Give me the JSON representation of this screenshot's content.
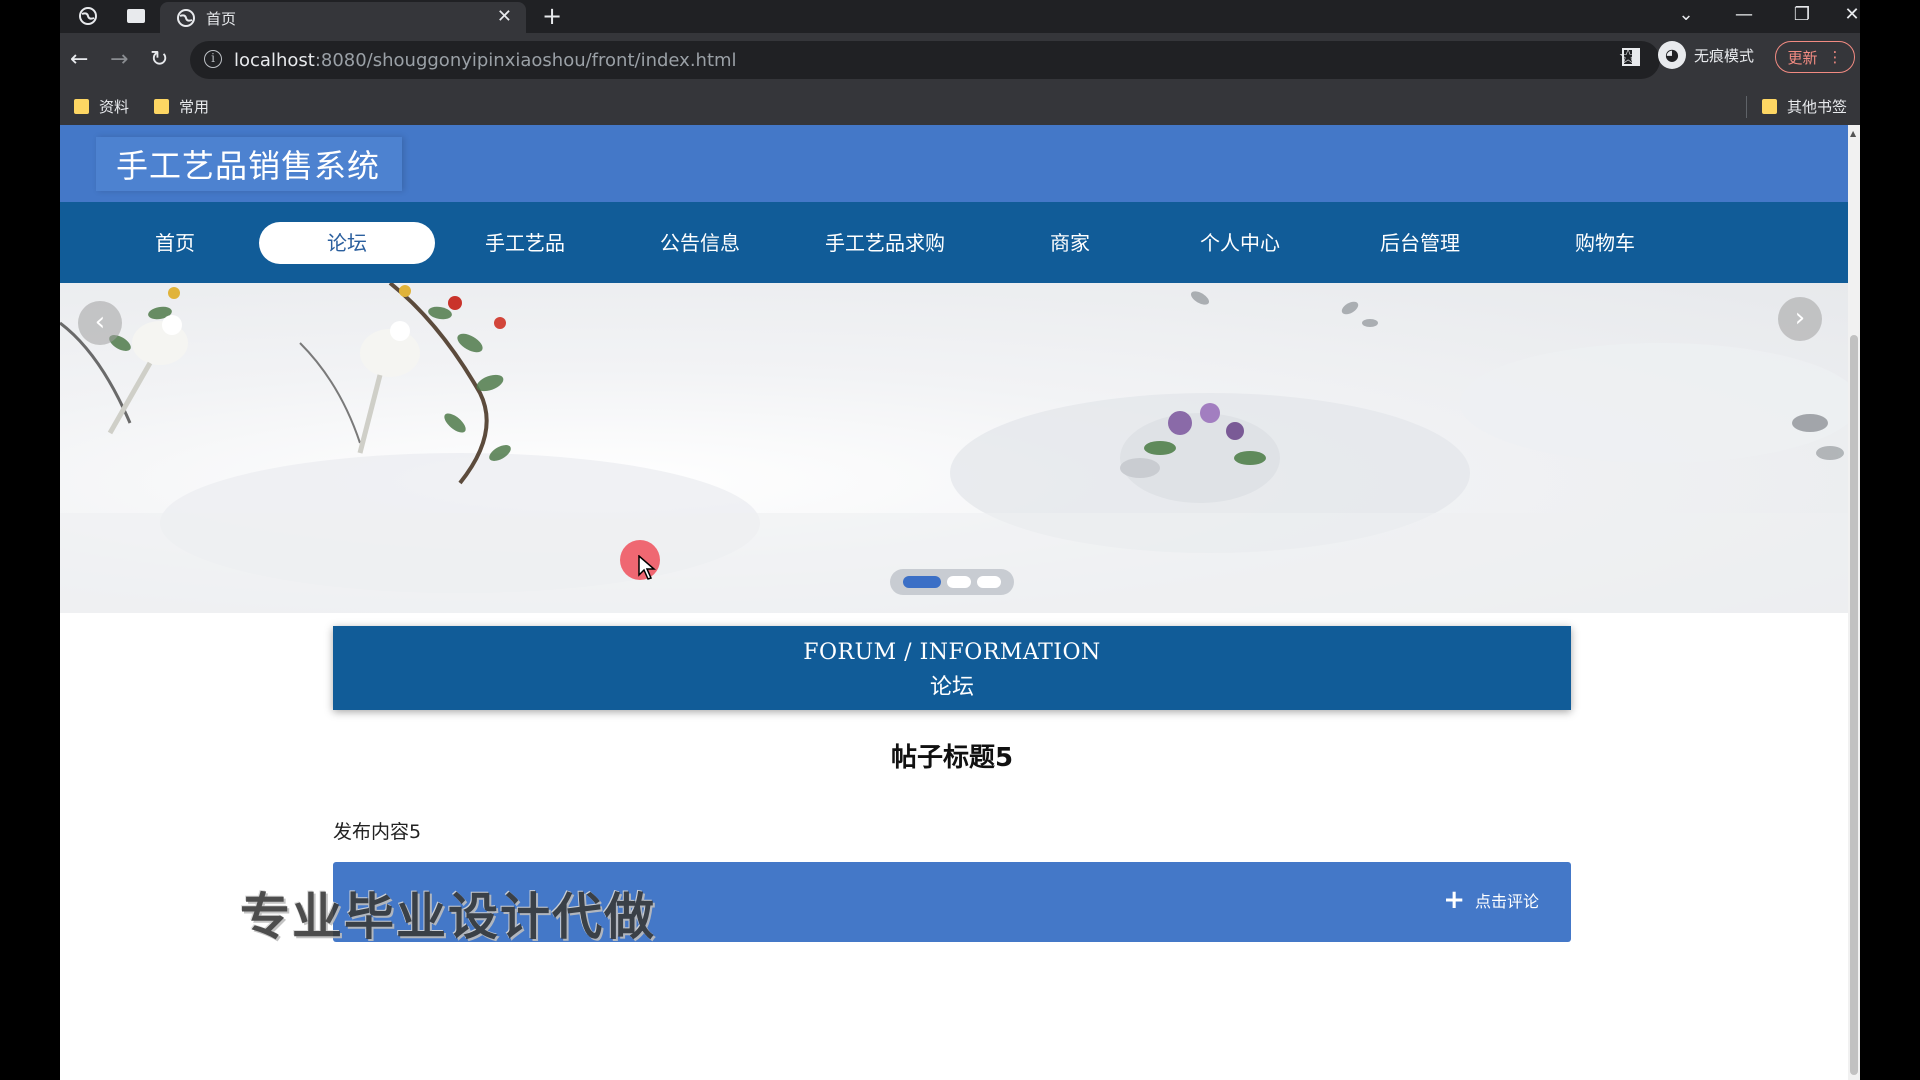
{
  "browser": {
    "tab_title": "首页",
    "url_host": "localhost",
    "url_rest": ":8080/shouggonyipinxiaoshou/front/index.html",
    "incognito_label": "无痕模式",
    "update_label": "更新",
    "bookmarks": [
      "资料",
      "常用"
    ],
    "other_bookmarks": "其他书签"
  },
  "site": {
    "title": "手工艺品销售系统",
    "nav": [
      "首页",
      "论坛",
      "手工艺品",
      "公告信息",
      "手工艺品求购",
      "商家",
      "个人中心",
      "后台管理",
      "购物车"
    ],
    "active_nav_index": 1
  },
  "banner": {
    "slide_count": 3,
    "active_slide": 0,
    "prev_icon": "chevron-left-icon",
    "next_icon": "chevron-right-icon"
  },
  "section": {
    "en": "FORUM / INFORMATION",
    "cn": "论坛"
  },
  "post": {
    "title": "帖子标题5",
    "content": "发布内容5",
    "comment_label": "点击评论"
  },
  "overlay": {
    "watermark": "专业毕业设计代做"
  },
  "colors": {
    "header_blue": "#4478c8",
    "nav_blue": "#115c98",
    "accent_dot": "#3b6fc6"
  }
}
